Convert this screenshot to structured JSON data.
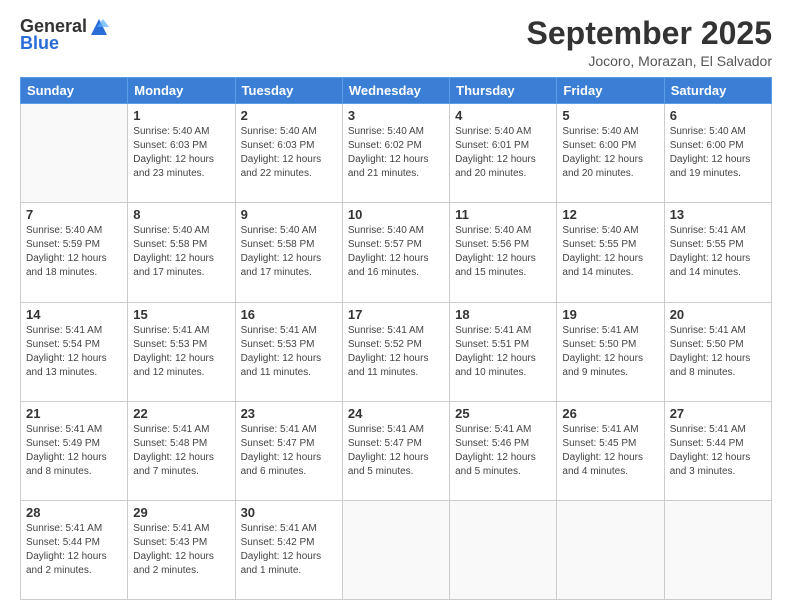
{
  "logo": {
    "general": "General",
    "blue": "Blue"
  },
  "title": "September 2025",
  "location": "Jocoro, Morazan, El Salvador",
  "days_of_week": [
    "Sunday",
    "Monday",
    "Tuesday",
    "Wednesday",
    "Thursday",
    "Friday",
    "Saturday"
  ],
  "weeks": [
    [
      {
        "day": "",
        "info": ""
      },
      {
        "day": "1",
        "info": "Sunrise: 5:40 AM\nSunset: 6:03 PM\nDaylight: 12 hours\nand 23 minutes."
      },
      {
        "day": "2",
        "info": "Sunrise: 5:40 AM\nSunset: 6:03 PM\nDaylight: 12 hours\nand 22 minutes."
      },
      {
        "day": "3",
        "info": "Sunrise: 5:40 AM\nSunset: 6:02 PM\nDaylight: 12 hours\nand 21 minutes."
      },
      {
        "day": "4",
        "info": "Sunrise: 5:40 AM\nSunset: 6:01 PM\nDaylight: 12 hours\nand 20 minutes."
      },
      {
        "day": "5",
        "info": "Sunrise: 5:40 AM\nSunset: 6:00 PM\nDaylight: 12 hours\nand 20 minutes."
      },
      {
        "day": "6",
        "info": "Sunrise: 5:40 AM\nSunset: 6:00 PM\nDaylight: 12 hours\nand 19 minutes."
      }
    ],
    [
      {
        "day": "7",
        "info": "Sunrise: 5:40 AM\nSunset: 5:59 PM\nDaylight: 12 hours\nand 18 minutes."
      },
      {
        "day": "8",
        "info": "Sunrise: 5:40 AM\nSunset: 5:58 PM\nDaylight: 12 hours\nand 17 minutes."
      },
      {
        "day": "9",
        "info": "Sunrise: 5:40 AM\nSunset: 5:58 PM\nDaylight: 12 hours\nand 17 minutes."
      },
      {
        "day": "10",
        "info": "Sunrise: 5:40 AM\nSunset: 5:57 PM\nDaylight: 12 hours\nand 16 minutes."
      },
      {
        "day": "11",
        "info": "Sunrise: 5:40 AM\nSunset: 5:56 PM\nDaylight: 12 hours\nand 15 minutes."
      },
      {
        "day": "12",
        "info": "Sunrise: 5:40 AM\nSunset: 5:55 PM\nDaylight: 12 hours\nand 14 minutes."
      },
      {
        "day": "13",
        "info": "Sunrise: 5:41 AM\nSunset: 5:55 PM\nDaylight: 12 hours\nand 14 minutes."
      }
    ],
    [
      {
        "day": "14",
        "info": "Sunrise: 5:41 AM\nSunset: 5:54 PM\nDaylight: 12 hours\nand 13 minutes."
      },
      {
        "day": "15",
        "info": "Sunrise: 5:41 AM\nSunset: 5:53 PM\nDaylight: 12 hours\nand 12 minutes."
      },
      {
        "day": "16",
        "info": "Sunrise: 5:41 AM\nSunset: 5:53 PM\nDaylight: 12 hours\nand 11 minutes."
      },
      {
        "day": "17",
        "info": "Sunrise: 5:41 AM\nSunset: 5:52 PM\nDaylight: 12 hours\nand 11 minutes."
      },
      {
        "day": "18",
        "info": "Sunrise: 5:41 AM\nSunset: 5:51 PM\nDaylight: 12 hours\nand 10 minutes."
      },
      {
        "day": "19",
        "info": "Sunrise: 5:41 AM\nSunset: 5:50 PM\nDaylight: 12 hours\nand 9 minutes."
      },
      {
        "day": "20",
        "info": "Sunrise: 5:41 AM\nSunset: 5:50 PM\nDaylight: 12 hours\nand 8 minutes."
      }
    ],
    [
      {
        "day": "21",
        "info": "Sunrise: 5:41 AM\nSunset: 5:49 PM\nDaylight: 12 hours\nand 8 minutes."
      },
      {
        "day": "22",
        "info": "Sunrise: 5:41 AM\nSunset: 5:48 PM\nDaylight: 12 hours\nand 7 minutes."
      },
      {
        "day": "23",
        "info": "Sunrise: 5:41 AM\nSunset: 5:47 PM\nDaylight: 12 hours\nand 6 minutes."
      },
      {
        "day": "24",
        "info": "Sunrise: 5:41 AM\nSunset: 5:47 PM\nDaylight: 12 hours\nand 5 minutes."
      },
      {
        "day": "25",
        "info": "Sunrise: 5:41 AM\nSunset: 5:46 PM\nDaylight: 12 hours\nand 5 minutes."
      },
      {
        "day": "26",
        "info": "Sunrise: 5:41 AM\nSunset: 5:45 PM\nDaylight: 12 hours\nand 4 minutes."
      },
      {
        "day": "27",
        "info": "Sunrise: 5:41 AM\nSunset: 5:44 PM\nDaylight: 12 hours\nand 3 minutes."
      }
    ],
    [
      {
        "day": "28",
        "info": "Sunrise: 5:41 AM\nSunset: 5:44 PM\nDaylight: 12 hours\nand 2 minutes."
      },
      {
        "day": "29",
        "info": "Sunrise: 5:41 AM\nSunset: 5:43 PM\nDaylight: 12 hours\nand 2 minutes."
      },
      {
        "day": "30",
        "info": "Sunrise: 5:41 AM\nSunset: 5:42 PM\nDaylight: 12 hours\nand 1 minute."
      },
      {
        "day": "",
        "info": ""
      },
      {
        "day": "",
        "info": ""
      },
      {
        "day": "",
        "info": ""
      },
      {
        "day": "",
        "info": ""
      }
    ]
  ]
}
